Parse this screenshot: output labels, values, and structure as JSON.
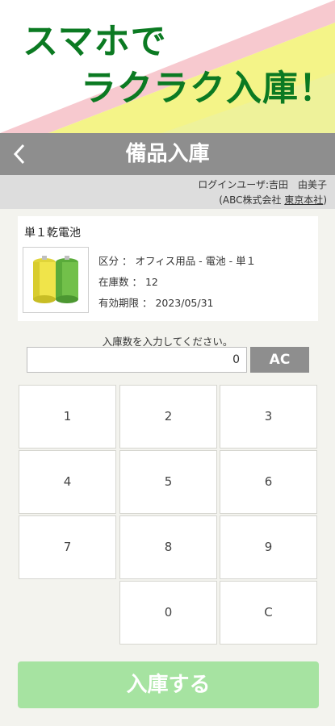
{
  "hero": {
    "line1": "スマホで",
    "line2": "ラクラク入庫！"
  },
  "header": {
    "title": "備品入庫",
    "back_icon": "chevron-left-icon"
  },
  "user": {
    "login_line": "ログインユーザ:吉田　由美子",
    "company_prefix": "(ABC株式会社 ",
    "branch": "東京本社",
    "company_suffix": ")"
  },
  "item": {
    "name": "単１乾電池",
    "category": "区分 ： オフィス用品 - 電池 - 単１",
    "stock": "在庫数 ： 12",
    "expiry": "有効期限 ： 2023/05/31"
  },
  "input": {
    "prompt": "入庫数を入力してください。",
    "value": "0",
    "clear_all_label": "AC"
  },
  "keypad": {
    "k1": "1",
    "k2": "2",
    "k3": "3",
    "k4": "4",
    "k5": "5",
    "k6": "6",
    "k7": "7",
    "k8": "8",
    "k9": "9",
    "k0": "0",
    "kc": "C"
  },
  "submit_label": "入庫する",
  "colors": {
    "brand_green": "#0b7a22",
    "header_gray": "#8e8e8e",
    "submit_green": "#a6e3a1",
    "hero_pink": "#f7c9cf",
    "hero_yellow": "#f4f488"
  }
}
